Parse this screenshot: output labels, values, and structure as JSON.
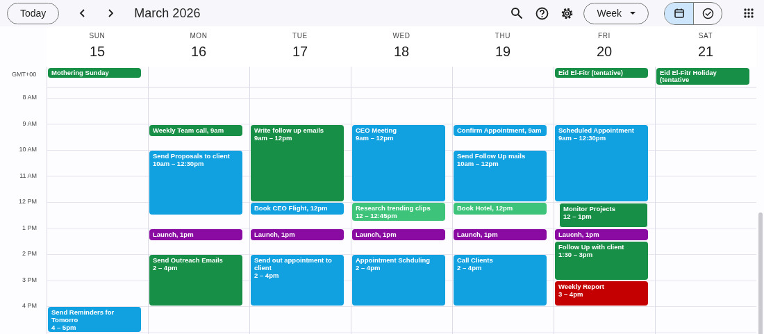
{
  "toolbar": {
    "today": "Today",
    "title": "March 2026",
    "view": "Week",
    "toggle": [
      {
        "kind": "calendar",
        "selected": true
      },
      {
        "kind": "tasks",
        "selected": false
      }
    ]
  },
  "timezone": "GMT+00",
  "hours": [
    "8 AM",
    "9 AM",
    "10 AM",
    "11 AM",
    "12 PM",
    "1 PM",
    "2 PM",
    "3 PM",
    "4 PM"
  ],
  "days": [
    {
      "name": "SUN",
      "date": "15",
      "all_day": [
        {
          "title": "Mothering Sunday",
          "color": "#188f46"
        }
      ],
      "events": [
        {
          "title": "Send Reminders for Tomorro",
          "time": "4 – 5pm",
          "color": "#12a1e0",
          "indent": false
        }
      ]
    },
    {
      "name": "MON",
      "date": "16",
      "events": [
        {
          "title": "Weekly Team call, 9am",
          "color": "#188f46",
          "indent": false
        },
        {
          "title": "Send Proposals to client",
          "time": "10am – 12:30pm",
          "color": "#12a1e0",
          "indent": false
        },
        {
          "title": "Launch, 1pm",
          "color": "#8a0ba2",
          "indent": false
        },
        {
          "title": "Send Outreach Emails",
          "time": "2 – 4pm",
          "color": "#188f46",
          "indent": false
        }
      ]
    },
    {
      "name": "TUE",
      "date": "17",
      "events": [
        {
          "title": "Write follow up emails",
          "time": "9am – 12pm",
          "color": "#188f46",
          "indent": false
        },
        {
          "title": "Book CEO Flight, 12pm",
          "color": "#12a1e0",
          "indent": false
        },
        {
          "title": "Launch, 1pm",
          "color": "#8a0ba2",
          "indent": false
        },
        {
          "title": "Send out appointment to client",
          "time": "2 – 4pm",
          "color": "#12a1e0",
          "indent": false
        }
      ]
    },
    {
      "name": "WED",
      "date": "18",
      "events": [
        {
          "title": "CEO Meeting",
          "time": "9am – 12pm",
          "color": "#12a1e0",
          "indent": false
        },
        {
          "title": "Research trending clips",
          "time": "12 – 12:45pm",
          "color": "#3dc47a",
          "indent": false
        },
        {
          "title": "Launch, 1pm",
          "color": "#8a0ba2",
          "indent": false
        },
        {
          "title": "Appointment Schduling",
          "time": "2 – 4pm",
          "color": "#12a1e0",
          "indent": false
        }
      ]
    },
    {
      "name": "THU",
      "date": "19",
      "events": [
        {
          "title": "Confirm Appointment, 9am",
          "color": "#12a1e0",
          "indent": false
        },
        {
          "title": "Send Follow Up mails",
          "time": "10am – 12pm",
          "color": "#12a1e0",
          "indent": false
        },
        {
          "title": "Book Hotel, 12pm",
          "color": "#3dc47a",
          "indent": false
        },
        {
          "title": "Launch, 1pm",
          "color": "#8a0ba2",
          "indent": false
        },
        {
          "title": "Call Clients",
          "time": "2 – 4pm",
          "color": "#12a1e0",
          "indent": false
        }
      ]
    },
    {
      "name": "FRI",
      "date": "20",
      "all_day": [
        {
          "title": "Eid El-Fitr (tentative)",
          "color": "#188f46"
        }
      ],
      "events": [
        {
          "title": "Scheduled Appointment",
          "time": "9am – 12:30pm",
          "color": "#12a1e0",
          "indent": false
        },
        {
          "title": "Monitor Projects",
          "time": "12 – 1pm",
          "color": "#188f46",
          "indent": true
        },
        {
          "title": "Laucnh, 1pm",
          "color": "#8a0ba2",
          "indent": false
        },
        {
          "title": "Follow Up with client",
          "time": "1:30 – 3pm",
          "color": "#188f46",
          "indent": false
        },
        {
          "title": "Weekly Report",
          "time": "3 – 4pm",
          "color": "#c50000",
          "indent": false
        }
      ]
    },
    {
      "name": "SAT",
      "date": "21",
      "all_day": [
        {
          "title": "Eid El-Fitr Holiday (tentative",
          "color": "#188f46"
        }
      ]
    }
  ]
}
